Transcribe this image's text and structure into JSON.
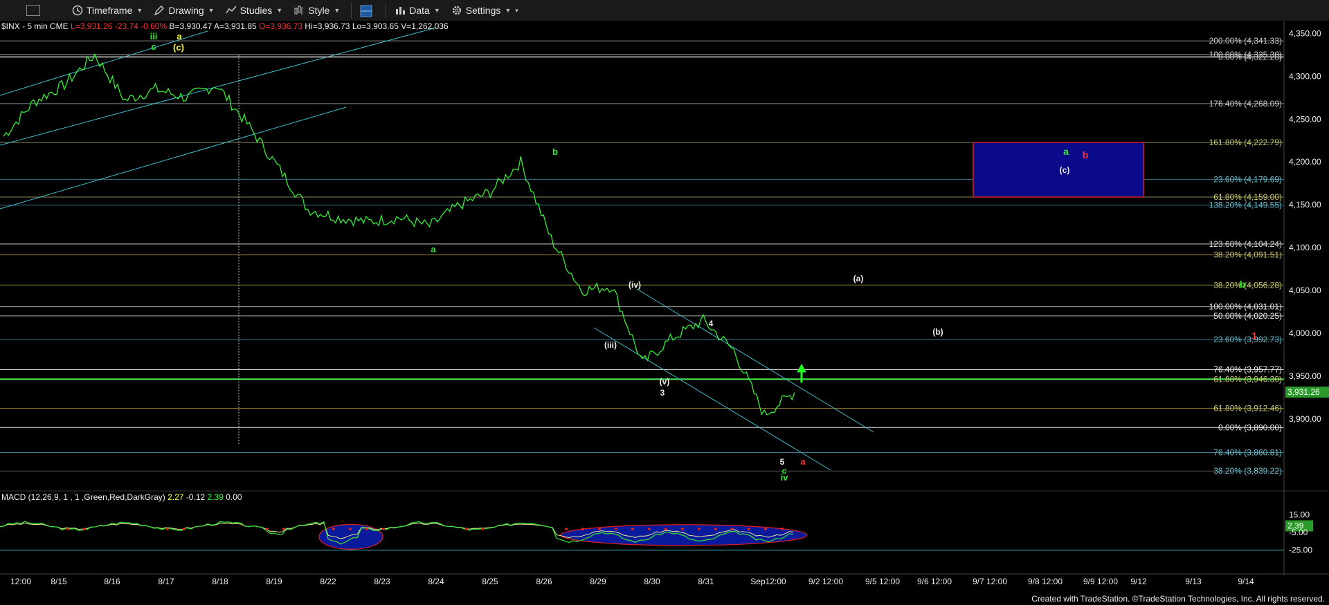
{
  "toolbar": {
    "timeframe": "Timeframe",
    "drawing": "Drawing",
    "studies": "Studies",
    "style": "Style",
    "data": "Data",
    "settings": "Settings"
  },
  "header": {
    "symbol": "$INX - 5 min  CME",
    "last": "L=3,931.26",
    "chg": "-23.74",
    "pct": "-0.60%",
    "bid": "B=3,930.47",
    "ask": "A=3,931.85",
    "open": "O=3,936.73",
    "high": "Hi=3,936.73",
    "low": "Lo=3,903.65",
    "vol": "V=1,262,036"
  },
  "macd_header": {
    "label": "MACD (12,26,9, 1 , 1 ,Green,Red,DarkGray)",
    "v1": "2.27",
    "v2": "-0.12",
    "v3": "2.39",
    "v4": "0.00"
  },
  "credit": "Created with TradeStation. ©TradeStation Technologies, Inc. All rights reserved.",
  "colors": {
    "price": "#33ee33",
    "channel": "#3fbfcf",
    "macd_blue": "#0a1a9a",
    "macd_red": "#e02020",
    "box": "#0a0a8a",
    "box_border": "#cc2222"
  },
  "chart_data": {
    "type": "line",
    "title": "",
    "xlabel": "",
    "ylabel": "",
    "x_ticks": [
      "12:00",
      "8/15",
      "8/16",
      "8/17",
      "8/18",
      "8/19",
      "8/22",
      "8/23",
      "8/24",
      "8/25",
      "8/26",
      "8/29",
      "8/30",
      "8/31",
      "Sep12:00",
      "9/2 12:00",
      "9/5 12:00",
      "9/6 12:00",
      "9/7 12:00",
      "9/8 12:00",
      "9/9 12:00",
      "9/12",
      "9/13",
      "9/14"
    ],
    "y_ticks": [
      4350,
      4300,
      4250,
      4200,
      4150,
      4100,
      4050,
      4000,
      3950,
      3900
    ],
    "y_tick_labels": [
      "4,350.00",
      "4,300.00",
      "4,250.00",
      "4,200.00",
      "4,150.00",
      "4,100.00",
      "4,050.00",
      "4,000.00",
      "3,950.00",
      "3,900.00"
    ],
    "ylim": [
      3820,
      4360
    ],
    "last_price": "3,931.26",
    "series": [
      {
        "x": [
          "8/15",
          "8/16",
          "8/16 12:00",
          "8/17",
          "8/17 12:00",
          "8/18",
          "8/18 12:00",
          "8/19",
          "8/19 12:00",
          "8/22",
          "8/22 12:00",
          "8/23",
          "8/23 12:00",
          "8/24",
          "8/24 12:00",
          "8/25",
          "8/25 12:00",
          "8/26",
          "8/26 12:00",
          "8/29",
          "8/29 12:00",
          "8/30",
          "8/30 12:00",
          "8/31",
          "8/31 12:00",
          "Sep",
          "Sep 12:00"
        ],
        "values": [
          4230,
          4270,
          4290,
          4325,
          4272,
          4285,
          4275,
          4290,
          4245,
          4195,
          4145,
          4135,
          4130,
          4135,
          4125,
          4150,
          4165,
          4200,
          4110,
          4050,
          4055,
          3965,
          3995,
          4015,
          3980,
          3905,
          3931
        ]
      }
    ],
    "fib_levels": [
      {
        "label": "200.00% (4,341.33)",
        "value": 4341.33
      },
      {
        "label": "100.00% (4,325.30)",
        "value": 4325.3
      },
      {
        "label": "0.00% (4,322.28)",
        "value": 4322.28
      },
      {
        "label": "176.40% (4,268.09)",
        "value": 4268.09
      },
      {
        "label": "161.80% (4,222.79)",
        "value": 4222.79
      },
      {
        "label": "23.60% (4,179.69)",
        "value": 4179.69
      },
      {
        "label": "61.80% (4,159.00)",
        "value": 4159.0
      },
      {
        "label": "138.20% (4,149.55)",
        "value": 4149.55
      },
      {
        "label": "123.60% (4,104.24)",
        "value": 4104.24
      },
      {
        "label": "38.20% (4,091.51)",
        "value": 4091.51
      },
      {
        "label": "38.20% (4,056.28)",
        "value": 4056.28
      },
      {
        "label": "100.00% (4,031.01)",
        "value": 4031.01
      },
      {
        "label": "50.00% (4,020.25)",
        "value": 4020.25
      },
      {
        "label": "23.60% (3,992.73)",
        "value": 3992.73
      },
      {
        "label": "76.40% (3,957.77)",
        "value": 3957.77
      },
      {
        "label": "61.80% (3,946.30)",
        "value": 3946.3
      },
      {
        "label": "61.80% (3,912.46)",
        "value": 3912.46
      },
      {
        "label": "0.00% (3,890.00)",
        "value": 3890.0
      },
      {
        "label": "76.40% (3,860.81)",
        "value": 3860.81
      },
      {
        "label": "38.20% (3,839.22)",
        "value": 3839.22
      }
    ],
    "wave_labels": [
      {
        "text": "iii",
        "color": "#33ee33"
      },
      {
        "text": "a",
        "color": "#ffff33"
      },
      {
        "text": "c",
        "color": "#33ee33"
      },
      {
        "text": "(c)",
        "color": "#ffff33"
      },
      {
        "text": "b",
        "color": "#33ee33"
      },
      {
        "text": "a",
        "color": "#33ee33"
      },
      {
        "text": "(iv)",
        "color": "#eeeeee"
      },
      {
        "text": "(iii)",
        "color": "#eeeeee"
      },
      {
        "text": "(v)",
        "color": "#eeeeee"
      },
      {
        "text": "3",
        "color": "#eeeeee"
      },
      {
        "text": "4",
        "color": "#eeeeee"
      },
      {
        "text": "5",
        "color": "#eeeeee"
      },
      {
        "text": "c",
        "color": "#33ee33"
      },
      {
        "text": "iv",
        "color": "#33ee33"
      },
      {
        "text": "a",
        "color": "#ff3333"
      },
      {
        "text": "(a)",
        "color": "#eeeeee"
      },
      {
        "text": "(b)",
        "color": "#eeeeee"
      },
      {
        "text": "(c)",
        "color": "#eeeeee"
      },
      {
        "text": "a",
        "color": "#33ee33"
      },
      {
        "text": "b",
        "color": "#ff3333"
      },
      {
        "text": "b",
        "color": "#33ee33"
      },
      {
        "text": "1",
        "color": "#ff3333"
      }
    ],
    "target_box": {
      "low": 4159.0,
      "high": 4222.79
    },
    "macd": {
      "y_tick_labels": [
        "15.00",
        "-5.00",
        "-25.00"
      ],
      "y_ticks": [
        15,
        -5,
        -25
      ],
      "ylim": [
        -30,
        20
      ],
      "last": "2.39"
    }
  }
}
